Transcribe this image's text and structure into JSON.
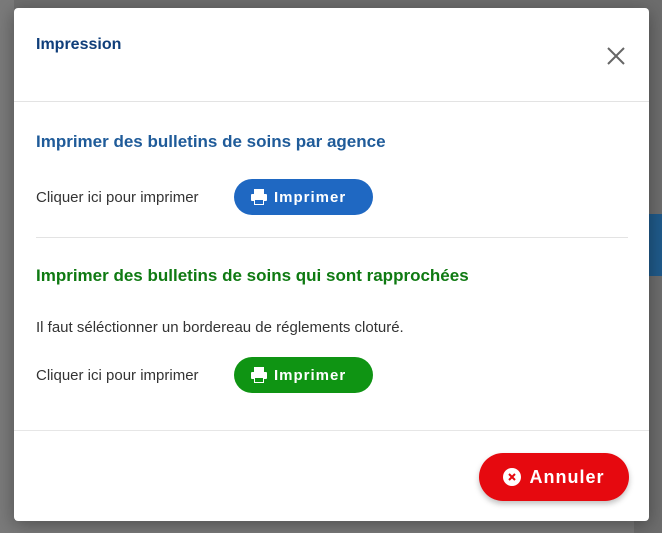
{
  "modal": {
    "title": "Impression",
    "close_icon": "close-icon"
  },
  "sections": [
    {
      "title": "Imprimer des bulletins de soins par agence",
      "action_text": "Cliquer ici pour imprimer",
      "button_label": "Imprimer",
      "button_icon": "printer-icon",
      "color": "#1f68c2"
    },
    {
      "title": "Imprimer des bulletins de soins qui sont rapprochées",
      "note": "Il faut séléctionner un bordereau de réglements cloturé.",
      "action_text": "Cliquer ici pour imprimer",
      "button_label": "Imprimer",
      "button_icon": "printer-icon",
      "color": "#0f9413"
    }
  ],
  "footer": {
    "cancel_label": "Annuler",
    "cancel_icon": "cancel-circle-icon",
    "cancel_color": "#e6090f"
  }
}
